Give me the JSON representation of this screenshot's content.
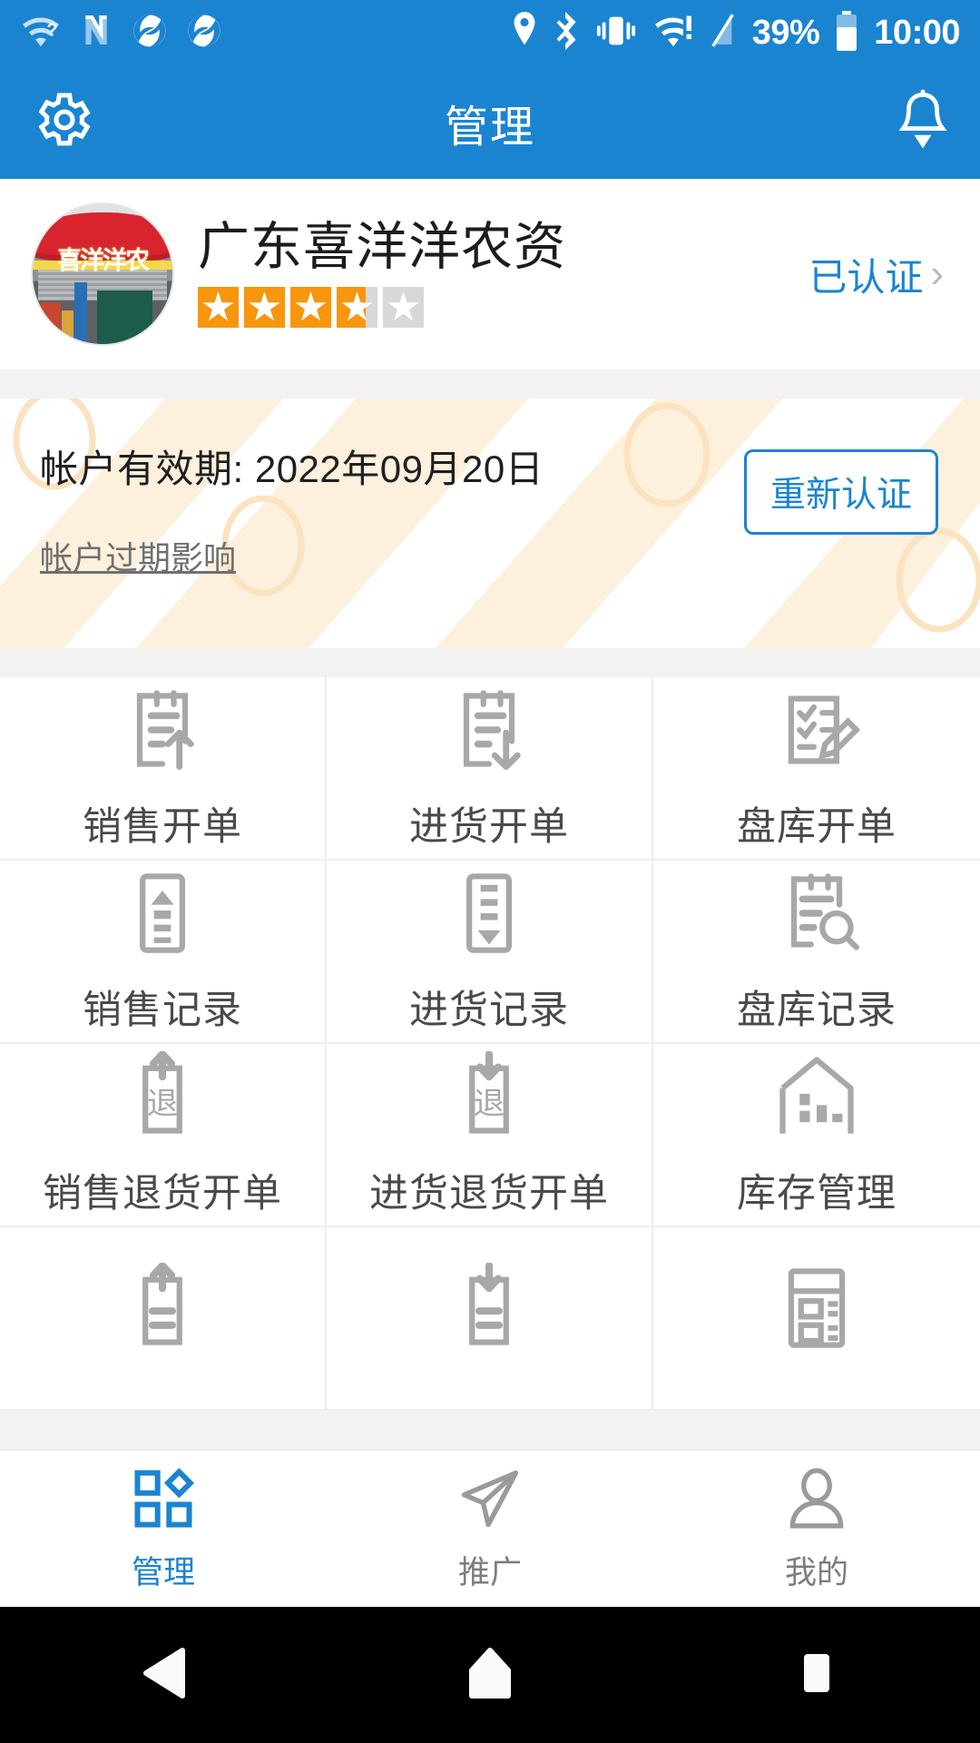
{
  "colors": {
    "primary": "#1b84d1",
    "star_filled": "#f8960d",
    "star_empty": "#d8d8d8",
    "icon_gray": "#9a9a9a",
    "nav_active": "#1b84d1",
    "watermark": "#fbe3c0"
  },
  "statusbar": {
    "icons_left": [
      "wifi-question-icon",
      "nfc-n-icon",
      "sync-icon",
      "sync-icon"
    ],
    "icons_right": [
      "location-icon",
      "bluetooth-icon",
      "vibrate-icon",
      "wifi-alert-icon",
      "signal-slash-icon"
    ],
    "battery_percent": "39%",
    "battery_icon": "battery-icon",
    "time": "10:00"
  },
  "appbar": {
    "settings_icon": "gear-icon",
    "title": "管理",
    "notification_icon": "bell-icon"
  },
  "profile": {
    "avatar_name": "store-avatar",
    "avatar_sign_text": "喜洋洋农",
    "store_name": "广东喜洋洋农资",
    "rating_value": 3.7,
    "rating_max": 5,
    "verify_label": "已认证",
    "chevron": "›"
  },
  "banner": {
    "expiry_label": "帐户有效期: 2022年09月20日",
    "impact_link": "帐户过期影响",
    "recertify_button": "重新认证"
  },
  "grid": {
    "items": [
      {
        "label": "销售开单",
        "icon": "doc-arrow-up-icon"
      },
      {
        "label": "进货开单",
        "icon": "doc-arrow-down-icon"
      },
      {
        "label": "盘库开单",
        "icon": "checklist-pencil-icon"
      },
      {
        "label": "销售记录",
        "icon": "list-up-box-icon"
      },
      {
        "label": "进货记录",
        "icon": "list-down-box-icon"
      },
      {
        "label": "盘库记录",
        "icon": "doc-search-icon"
      },
      {
        "label": "销售退货开单",
        "icon": "return-up-icon"
      },
      {
        "label": "进货退货开单",
        "icon": "return-down-icon"
      },
      {
        "label": "库存管理",
        "icon": "warehouse-icon"
      },
      {
        "label": "",
        "icon": "doc-equal-up-icon"
      },
      {
        "label": "",
        "icon": "doc-equal-down-icon"
      },
      {
        "label": "",
        "icon": "report-list-icon"
      }
    ]
  },
  "bottomnav": {
    "items": [
      {
        "label": "管理",
        "icon": "grid-diamond-icon",
        "active": true
      },
      {
        "label": "推广",
        "icon": "paper-plane-icon",
        "active": false
      },
      {
        "label": "我的",
        "icon": "person-icon",
        "active": false
      }
    ]
  },
  "androidnav": {
    "back": "back-triangle-icon",
    "home": "home-pentagon-icon",
    "recents": "recents-square-icon"
  }
}
